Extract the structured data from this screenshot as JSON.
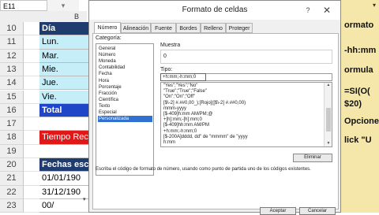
{
  "excel": {
    "name_box": "E11",
    "col_header": "B",
    "rows": [
      {
        "num": "10",
        "text": "Día",
        "style": "navy"
      },
      {
        "num": "11",
        "text": "Lun.",
        "style": "cyan"
      },
      {
        "num": "12",
        "text": "Mar.",
        "style": "cyan"
      },
      {
        "num": "13",
        "text": "Mie.",
        "style": "cyan"
      },
      {
        "num": "14",
        "text": "Jue.",
        "style": "cyan"
      },
      {
        "num": "15",
        "text": "Vie.",
        "style": "cyan"
      },
      {
        "num": "16",
        "text": "Total",
        "style": "blue"
      },
      {
        "num": "17",
        "text": "",
        "style": "white"
      },
      {
        "num": "18",
        "text": "Tiempo Rec",
        "style": "red"
      },
      {
        "num": "19",
        "text": "",
        "style": "white"
      },
      {
        "num": "20",
        "text": "Fechas esc",
        "style": "navy"
      },
      {
        "num": "21",
        "text": "01/01/190",
        "style": "white"
      },
      {
        "num": "22",
        "text": "31/12/190",
        "style": "white"
      },
      {
        "num": "23",
        "text": "00/",
        "style": "white"
      }
    ],
    "right_texts": [
      "ormato",
      "-hh:mm",
      "ormula",
      "=SI(O(",
      "$20)",
      "Opcione",
      "lick \"U"
    ]
  },
  "dialog": {
    "title": "Formato de celdas",
    "help": "?",
    "close": "✕",
    "tabs": [
      "Número",
      "Alineación",
      "Fuente",
      "Bordes",
      "Relleno",
      "Proteger"
    ],
    "active_tab": 0,
    "category_label": "Categoría:",
    "categories": [
      "General",
      "Número",
      "Moneda",
      "Contabilidad",
      "Fecha",
      "Hora",
      "Porcentaje",
      "Fracción",
      "Científica",
      "Texto",
      "Especial",
      "Personalizada"
    ],
    "selected_category": 11,
    "sample_label": "Muestra",
    "sample_value": "0",
    "type_label": "Tipo:",
    "type_value": "+h:mm;-h:mm;0",
    "formats": [
      "\"Yes\";\"Yes\";\"No\"",
      "\"True\";\"True\";\"False\"",
      "\"On\";\"On\";\"Off\"",
      "[$\\-2] #.##0,00_);[Rojo]([$\\-2] #.##0,00)",
      "mmm-yyyy",
      "[$-409]h:mm AM/PM;@",
      "+[h]:mm;-[h]:mm;0",
      "[$-409]hh:mm AM/PM",
      "+h:mm;-h:mm;0",
      "[$-200A]dddd, dd\" de \"mmmm\" de \"yyyy",
      "h:mm"
    ],
    "delete_label": "Eliminar",
    "description": "Escriba el código de formato de número, usando como punto de partida uno de los códigos existentes.",
    "ok_label": "Aceptar",
    "cancel_label": "Cancelar"
  }
}
